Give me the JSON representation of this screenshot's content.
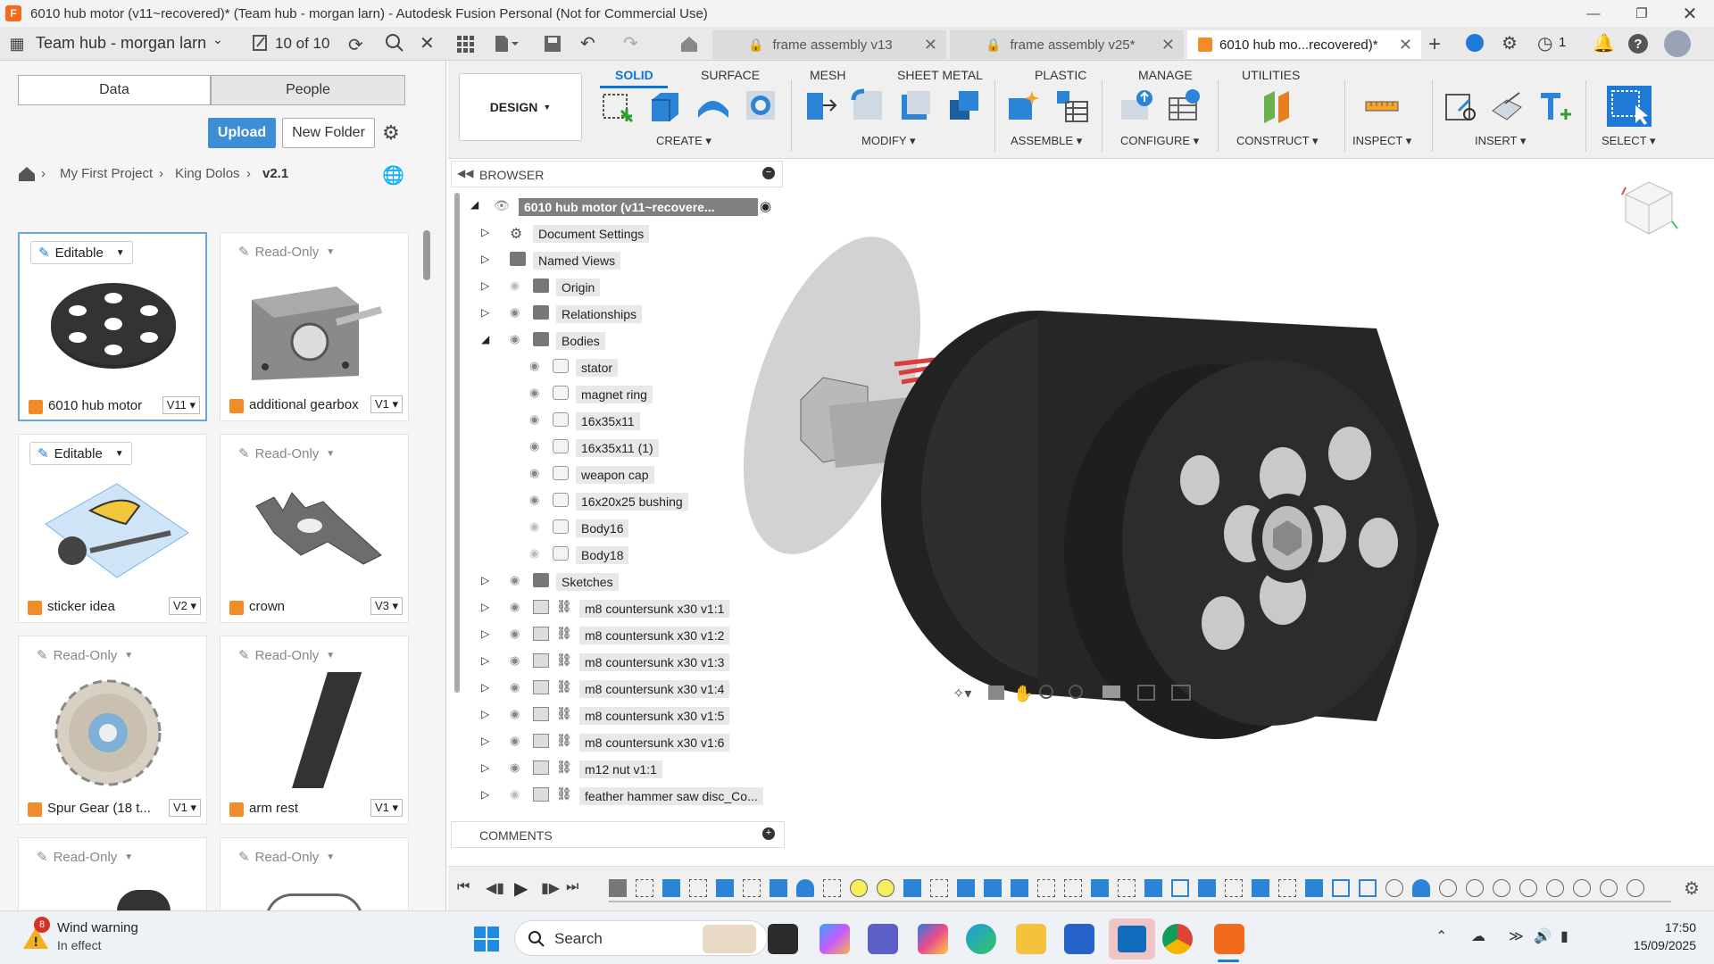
{
  "window": {
    "title": "6010 hub motor (v11~recovered)* (Team hub - morgan larn) - Autodesk Fusion Personal (Not for Commercial Use)",
    "app_icon": "F"
  },
  "apptoolbar": {
    "team": "Team hub - morgan larn",
    "job_counter": "10 of 10",
    "tabs": [
      {
        "label": "frame assembly v13"
      },
      {
        "label": "frame assembly v25*"
      },
      {
        "label": "6010 hub mo...recovered)*"
      }
    ],
    "clock_count": "1"
  },
  "data_panel": {
    "seg_data": "Data",
    "seg_people": "People",
    "upload": "Upload",
    "new_folder": "New Folder",
    "breadcrumb": [
      "My First Project",
      "King Dolos",
      "v2.1"
    ],
    "cards": [
      {
        "badge": "Editable",
        "name": "6010 hub motor",
        "version": "V11"
      },
      {
        "badge": "Read-Only",
        "name": "additional gearbox",
        "version": "V1"
      },
      {
        "badge": "Editable",
        "name": "sticker idea",
        "version": "V2"
      },
      {
        "badge": "Read-Only",
        "name": "crown",
        "version": "V3"
      },
      {
        "badge": "Read-Only",
        "name": "Spur Gear (18 t...",
        "version": "V1"
      },
      {
        "badge": "Read-Only",
        "name": "arm rest",
        "version": "V1"
      },
      {
        "badge": "Read-Only"
      },
      {
        "badge": "Read-Only"
      }
    ]
  },
  "ribbon": {
    "design": "DESIGN",
    "tabs": [
      "SOLID",
      "SURFACE",
      "MESH",
      "SHEET METAL",
      "PLASTIC",
      "MANAGE",
      "UTILITIES"
    ],
    "groups": [
      "CREATE",
      "MODIFY",
      "ASSEMBLE",
      "CONFIGURE",
      "CONSTRUCT",
      "INSPECT",
      "INSERT",
      "SELECT"
    ]
  },
  "browser": {
    "title": "BROWSER",
    "root": "6010 hub motor (v11~recovere...",
    "items": [
      {
        "label": "Document Settings"
      },
      {
        "label": "Named Views"
      },
      {
        "label": "Origin"
      },
      {
        "label": "Relationships"
      },
      {
        "label": "Bodies"
      },
      {
        "label": "stator"
      },
      {
        "label": "magnet ring"
      },
      {
        "label": "16x35x11"
      },
      {
        "label": "16x35x11 (1)"
      },
      {
        "label": "weapon cap"
      },
      {
        "label": "16x20x25 bushing"
      },
      {
        "label": "Body16"
      },
      {
        "label": "Body18"
      },
      {
        "label": "Sketches"
      },
      {
        "label": "m8 countersunk x30 v1:1"
      },
      {
        "label": "m8 countersunk x30 v1:2"
      },
      {
        "label": "m8 countersunk x30 v1:3"
      },
      {
        "label": "m8 countersunk x30 v1:4"
      },
      {
        "label": "m8 countersunk x30 v1:5"
      },
      {
        "label": "m8 countersunk x30 v1:6"
      },
      {
        "label": "m12 nut v1:1"
      },
      {
        "label": "feather hammer saw disc_Co..."
      }
    ],
    "comments": "COMMENTS"
  },
  "taskbar": {
    "weather_title": "Wind warning",
    "weather_sub": "In effect",
    "weather_badge": "8",
    "search": "Search",
    "time": "17:50",
    "date": "15/09/2025"
  },
  "colors": {
    "accent": "#0a76d6",
    "upload": "#3c8fd6",
    "orange": "#f28c28",
    "model": "#1f1f1f"
  }
}
